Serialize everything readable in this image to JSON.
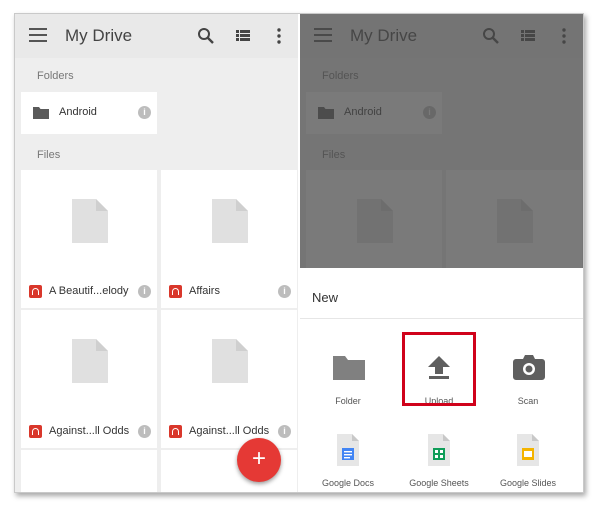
{
  "drive": {
    "title": "My Drive",
    "folders_label": "Folders",
    "files_label": "Files",
    "folders": [
      {
        "name": "Android"
      }
    ],
    "files": [
      {
        "name": "A Beautif...elody"
      },
      {
        "name": "Affairs"
      },
      {
        "name": "Against...ll Odds"
      },
      {
        "name": "Against...ll Odds"
      }
    ],
    "fab_label": "+",
    "info_glyph": "i"
  },
  "new_sheet": {
    "title": "New",
    "items": [
      {
        "label": "Folder",
        "icon": "folder-icon"
      },
      {
        "label": "Upload",
        "icon": "upload-icon",
        "highlighted": true
      },
      {
        "label": "Scan",
        "icon": "camera-icon"
      },
      {
        "label": "Google Docs",
        "icon": "google-docs-icon"
      },
      {
        "label": "Google Sheets",
        "icon": "google-sheets-icon"
      },
      {
        "label": "Google Slides",
        "icon": "google-slides-icon"
      }
    ]
  },
  "colors": {
    "accent": "#e53935",
    "highlight": "#d0021b",
    "docs": "#4285f4",
    "sheets": "#0f9d58",
    "slides": "#f4b400",
    "audio": "#d9372b"
  }
}
